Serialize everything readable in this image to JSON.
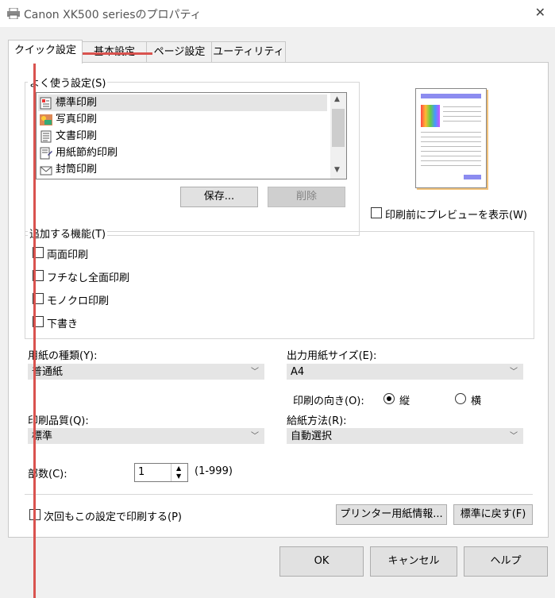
{
  "window": {
    "title": "Canon XK500 seriesのプロパティ"
  },
  "tabs": [
    {
      "label": "クイック設定"
    },
    {
      "label": "基本設定"
    },
    {
      "label": "ページ設定"
    },
    {
      "label": "ユーティリティ"
    }
  ],
  "favorites": {
    "label": "よく使う設定(S)",
    "items": [
      {
        "label": "標準印刷",
        "icon": "document-color-icon"
      },
      {
        "label": "写真印刷",
        "icon": "photo-icon"
      },
      {
        "label": "文書印刷",
        "icon": "document-text-icon"
      },
      {
        "label": "用紙節約印刷",
        "icon": "paper-save-icon"
      },
      {
        "label": "封筒印刷",
        "icon": "envelope-icon"
      }
    ],
    "save_label": "保存...",
    "delete_label": "削除"
  },
  "preview_option": {
    "label": "印刷前にプレビューを表示(W)"
  },
  "additional": {
    "label": "追加する機能(T)",
    "items": [
      {
        "label": "両面印刷"
      },
      {
        "label": "フチなし全面印刷"
      },
      {
        "label": "モノクロ印刷"
      },
      {
        "label": "下書き"
      }
    ]
  },
  "media_type": {
    "label": "用紙の種類(Y):",
    "value": "普通紙"
  },
  "output_size": {
    "label": "出力用紙サイズ(E):",
    "value": "A4"
  },
  "orientation": {
    "label": "印刷の向き(O):",
    "portrait": "縦",
    "landscape": "横",
    "selected": "portrait"
  },
  "quality": {
    "label": "印刷品質(Q):",
    "value": "標準"
  },
  "paper_source": {
    "label": "給紙方法(R):",
    "value": "自動選択"
  },
  "copies": {
    "label": "部数(C):",
    "value": "1",
    "range": "(1-999)"
  },
  "always_print": {
    "label": "次回もこの設定で印刷する(P)"
  },
  "printer_media_info_label": "プリンター用紙情報...",
  "defaults_label": "標準に戻す(F)",
  "footer": {
    "ok": "OK",
    "cancel": "キャンセル",
    "help": "ヘルプ"
  },
  "colors": {
    "annotation_line": "#d9534f",
    "preview_bar": "#8c8cf0"
  }
}
